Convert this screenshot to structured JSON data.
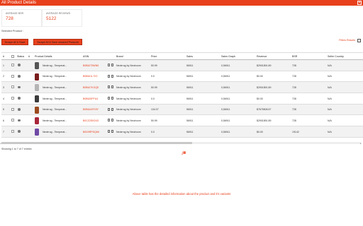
{
  "window": {
    "title": "All Product Details",
    "close_icon": "close-icon"
  },
  "stats": [
    {
      "label": "AVERAGE BSR",
      "value": "728"
    },
    {
      "label": "AVERAGE REVIEWS",
      "value": "5122"
    }
  ],
  "selected_product_label": "Selected Product :",
  "buttons": {
    "scrape_all": "Scrape All & Save",
    "scrape_unsaved": "Scrape All & Save unsaved Products"
  },
  "filters_label": "Filters Results",
  "table": {
    "headers": [
      "#",
      "",
      "Status",
      "#",
      "Product Details",
      "ASIN",
      "",
      "Brand",
      "Price",
      "Sales",
      "Sales Graph",
      "Revenue",
      "BSR",
      "Seller Country"
    ],
    "rows": [
      {
        "num": "1",
        "product": "Neotrrug - Temperat...",
        "asin": "B0B6JT5WN5",
        "brand": "Neotrrug by Neotroom",
        "price": "50.99",
        "sales": "56911",
        "graph": "0,56911",
        "revenue": "$2901891.89",
        "bsr": "728",
        "country": "N/A",
        "color": "#555555"
      },
      {
        "num": "2",
        "product": "Neotrrug - Temperat...",
        "asin": "B0B6J1L7X2",
        "brand": "Neotrrug by Neotroom",
        "price": "0.0",
        "sales": "56911",
        "graph": "0,56911",
        "revenue": "$0.00",
        "bsr": "728",
        "country": "N/A",
        "color": "#7a1d1d"
      },
      {
        "num": "3",
        "product": "Neotrrug - Temperat...",
        "asin": "B0B6J7KGQ5",
        "brand": "Neotrrug by Neotroom",
        "price": "50.99",
        "sales": "56911",
        "graph": "0,56911",
        "revenue": "$2901891.89",
        "bsr": "728",
        "country": "N/A",
        "color": "#b5b5b5"
      },
      {
        "num": "4",
        "product": "Neotrrug - Temperat...",
        "asin": "B0B6J5FPU4",
        "brand": "Neotrrug by Neotroom",
        "price": "0.0",
        "sales": "56911",
        "graph": "0,56911",
        "revenue": "$0.00",
        "bsr": "728",
        "country": "N/A",
        "color": "#3b3b3b"
      },
      {
        "num": "5",
        "product": "Neotrrug - Temperat...",
        "asin": "B0B6JAPG9Y",
        "brand": "Neotrrug by Neotroom",
        "price": "134.07",
        "sales": "56911",
        "graph": "0,56911",
        "revenue": "$7675506.57",
        "bsr": "728",
        "country": "N/A",
        "color": "#9b4a1e"
      },
      {
        "num": "6",
        "product": "Neotrrug - Temperat...",
        "asin": "B0CZ2SKD43",
        "brand": "Neotrrug by Neotroom",
        "price": "50.99",
        "sales": "56911",
        "graph": "0,56911",
        "revenue": "$2901891.89",
        "bsr": "728",
        "country": "N/A",
        "color": "#a8263a"
      },
      {
        "num": "7",
        "product": "Neotrrug - Temperat...",
        "asin": "B0D9RPDQ6K",
        "brand": "Neotrrug by Neotroom",
        "price": "0.0",
        "sales": "56911",
        "graph": "0,56911",
        "revenue": "$0.00",
        "bsr": "19142",
        "country": "N/A",
        "color": "#6f4aa5"
      }
    ]
  },
  "showing": "Showing 1 to 7 of 7 entries",
  "export_icons": [
    "download-icon",
    "spreadsheet-icon"
  ],
  "footnote": "Above table has the detailed information about the product and it's variants"
}
